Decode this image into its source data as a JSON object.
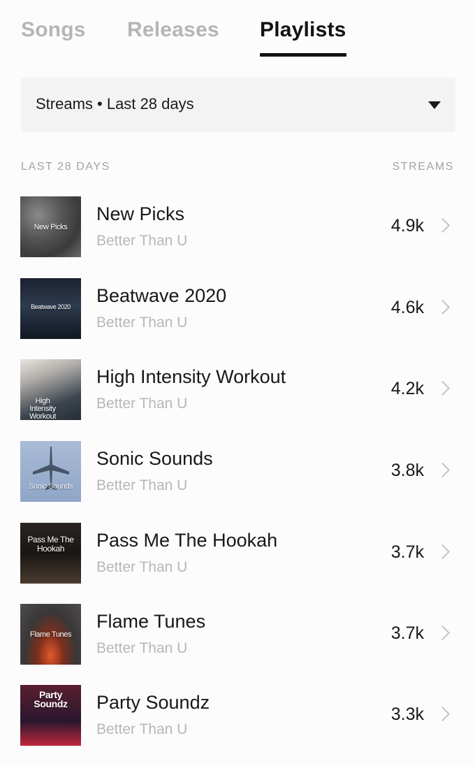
{
  "tabs": [
    {
      "label": "Songs",
      "active": false
    },
    {
      "label": "Releases",
      "active": false
    },
    {
      "label": "Playlists",
      "active": true
    }
  ],
  "filter": {
    "label": "Streams • Last 28 days"
  },
  "list_header": {
    "left": "LAST 28 DAYS",
    "right": "STREAMS"
  },
  "playlists": [
    {
      "title": "New Picks",
      "artist": "Better Than U",
      "streams": "4.9k",
      "cover_text": "New Picks"
    },
    {
      "title": "Beatwave 2020",
      "artist": "Better Than U",
      "streams": "4.6k",
      "cover_text": "Beatwave 2020"
    },
    {
      "title": "High Intensity Workout",
      "artist": "Better Than U",
      "streams": "4.2k",
      "cover_text": "High Intensity Workout"
    },
    {
      "title": "Sonic Sounds",
      "artist": "Better Than U",
      "streams": "3.8k",
      "cover_text": "Sonic Sounds"
    },
    {
      "title": "Pass Me The Hookah",
      "artist": "Better Than U",
      "streams": "3.7k",
      "cover_text": "Pass Me The Hookah"
    },
    {
      "title": "Flame Tunes",
      "artist": "Better Than U",
      "streams": "3.7k",
      "cover_text": "Flame Tunes"
    },
    {
      "title": "Party Soundz",
      "artist": "Better Than U",
      "streams": "3.3k",
      "cover_text": "Party Soundz"
    }
  ],
  "colors": {
    "active_tab": "#121212",
    "inactive_tab": "#b5b5b8",
    "dropdown_bg": "#f4f3f4",
    "secondary_text": "#b7b7b9"
  }
}
